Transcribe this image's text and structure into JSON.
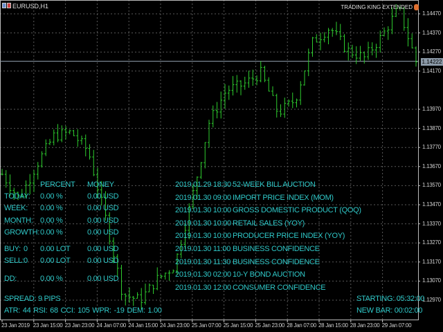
{
  "window": {
    "symbol": "EURUSD,H1",
    "indicator_title": "TRADING KING EXTENDED",
    "icons": [
      "chart-window-icon",
      "trading-king-icon"
    ]
  },
  "colors": {
    "background": "#000000",
    "bars": "#2ecc2e",
    "panel_text": "#2fc8c8",
    "grid": "#5a5a5a",
    "current_price_label": "#8c9aa8"
  },
  "chart_data": {
    "type": "ohlc",
    "price_axis": {
      "ticks": [
        "1.14470",
        "1.14370",
        "1.14270",
        "1.14170",
        "1.13970",
        "1.13870",
        "1.13770",
        "1.13670",
        "1.13570",
        "1.13470",
        "1.13370",
        "1.13270",
        "1.13170",
        "1.13070",
        "1.12970"
      ],
      "current_price": "1.14222",
      "range": [
        1.1292,
        1.1452
      ]
    },
    "time_axis": {
      "ticks": [
        "23 Jan 2019",
        "23 Jan 15:00",
        "23 Jan 23:00",
        "24 Jan 07:00",
        "24 Jan 15:00",
        "24 Jan 23:00",
        "25 Jan 07:00",
        "25 Jan 15:00",
        "25 Jan 23:00",
        "28 Jan 07:00",
        "28 Jan 15:00",
        "28 Jan 23:00",
        "29 Jan 07:00"
      ]
    },
    "grid": true,
    "approx_close_path": [
      1.1363,
      1.135,
      1.1368,
      1.1383,
      1.1385,
      1.1375,
      1.134,
      1.13,
      1.1297,
      1.1308,
      1.1315,
      1.135,
      1.139,
      1.1407,
      1.141,
      1.1416,
      1.1395,
      1.1402,
      1.1432,
      1.144,
      1.1428,
      1.1424,
      1.1435,
      1.145,
      1.1422
    ]
  },
  "panel": {
    "headers": {
      "percent": "PERCENT",
      "money": "MONEY"
    },
    "rows": [
      {
        "label": "TODAY:",
        "percent": "0.00 %",
        "money": "0.00 USD"
      },
      {
        "label": "WEEK:",
        "percent": "0.00 %",
        "money": "0.00 USD"
      },
      {
        "label": "MONTH:",
        "percent": "0.00 %",
        "money": "0.00 USD"
      },
      {
        "label": "GROWTH:",
        "percent": "0.00 %",
        "money": "0.00 USD"
      }
    ],
    "buy": {
      "label": "BUY:",
      "count": "0",
      "lots": "0.00 LOT",
      "money": "0.00 USD"
    },
    "sell": {
      "label": "SELL:",
      "count": "0",
      "lots": "0.00 LOT",
      "money": "0.00 USD"
    },
    "dd": {
      "label": "DD:",
      "percent": "0.00 %",
      "money": "0.00 USD"
    },
    "spread": "SPREAD: 9 PIPS",
    "indicators": "ATR: 44  RSI: 68  CCI: 105  WPR: -19  DEM: 1.00"
  },
  "news": [
    {
      "time": "2019.01.29 18:30",
      "event": "52-WEEK BILL AUCTION"
    },
    {
      "time": "2019.01.30 09:00",
      "event": "IMPORT PRICE INDEX (MOM)"
    },
    {
      "time": "2019.01.30 10:00",
      "event": "GROSS DOMESTIC PRODUCT (QOQ)"
    },
    {
      "time": "2019.01.30 10:00",
      "event": "RETAIL SALES (YOY)"
    },
    {
      "time": "2019.01.30 10:00",
      "event": "PRODUCER PRICE INDEX (YOY)"
    },
    {
      "time": "2019.01.30 11:00",
      "event": "BUSINESS CONFIDENCE"
    },
    {
      "time": "2019.01.30 11:30",
      "event": "BUSINESS CONFIDENCE"
    },
    {
      "time": "2019.01.30 02:00",
      "event": "10-Y BOND AUCTION"
    },
    {
      "time": "2019.01.30 12:00",
      "event": "CONSUMER CONFIDENCE"
    }
  ],
  "timers": {
    "starting": "STARTING: 05:32:00",
    "new_bar": "NEW BAR: 00:02:00"
  }
}
